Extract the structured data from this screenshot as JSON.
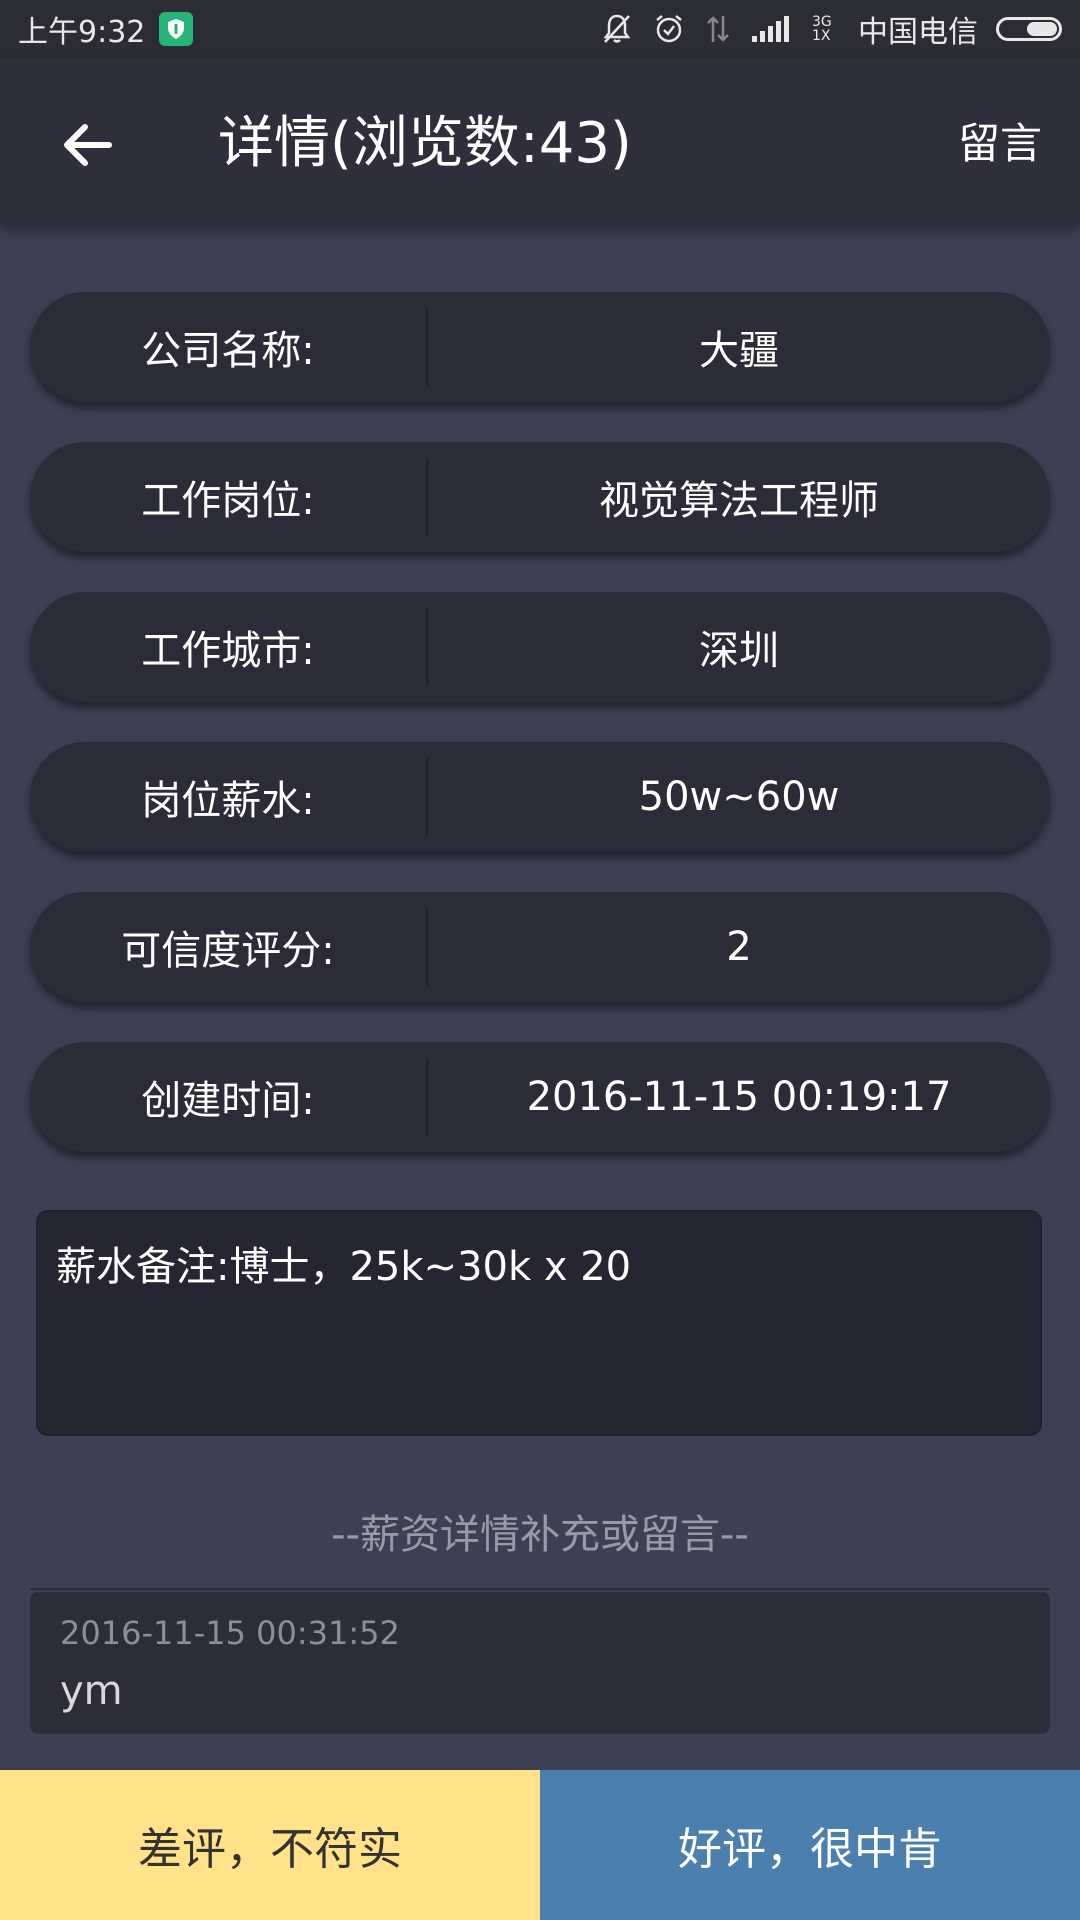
{
  "status_bar": {
    "time": "上午9:32",
    "network": "3G 1X",
    "carrier": "中国电信"
  },
  "header": {
    "title": "详情(浏览数:43)",
    "action_label": "留言",
    "back_icon": "arrow-left-icon"
  },
  "details": [
    {
      "label": "公司名称:",
      "value": "大疆"
    },
    {
      "label": "工作岗位:",
      "value": "视觉算法工程师"
    },
    {
      "label": "工作城市:",
      "value": "深圳"
    },
    {
      "label": "岗位薪水:",
      "value": "50w~60w"
    },
    {
      "label": "可信度评分:",
      "value": "2"
    },
    {
      "label": "创建时间:",
      "value": "2016-11-15 00:19:17"
    }
  ],
  "note": "薪水备注:博士，25k~30k x 20",
  "comments_section_title": "--薪资详情补充或留言--",
  "comments": [
    {
      "time": "2016-11-15 00:31:52",
      "text": "ym"
    }
  ],
  "buttons": {
    "bad_review": "差评，不符实",
    "good_review": "好评，很中肯"
  },
  "colors": {
    "background": "#3d3f52",
    "app_bar": "#2e2f3b",
    "bad_button": "#ffe28a",
    "good_button": "#4a7fae"
  }
}
